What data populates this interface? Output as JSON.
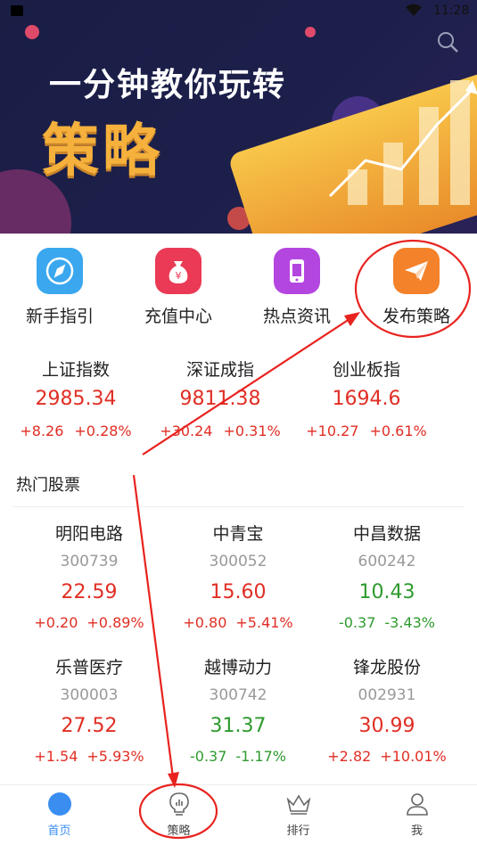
{
  "statusbar": {
    "time": "11:28"
  },
  "banner": {
    "title": "一分钟教你玩转",
    "big_text": "策略"
  },
  "quick_menu": [
    {
      "label": "新手指引",
      "icon": "compass-icon",
      "color": "#3aa7ef"
    },
    {
      "label": "充值中心",
      "icon": "money-bag-icon",
      "color": "#ea3a55"
    },
    {
      "label": "热点资讯",
      "icon": "phone-news-icon",
      "color": "#b446e0"
    },
    {
      "label": "发布策略",
      "icon": "paper-plane-icon",
      "color": "#f3822a"
    }
  ],
  "indices": [
    {
      "name": "上证指数",
      "value": "2985.34",
      "change": "+8.26",
      "percent": "+0.28%"
    },
    {
      "name": "深证成指",
      "value": "9811.38",
      "change": "+30.24",
      "percent": "+0.31%"
    },
    {
      "name": "创业板指",
      "value": "1694.6",
      "change": "+10.27",
      "percent": "+0.61%"
    }
  ],
  "hot_stocks": {
    "title": "热门股票",
    "items": [
      {
        "name": "明阳电路",
        "code": "300739",
        "price": "22.59",
        "change": "+0.20",
        "percent": "+0.89%",
        "trend": "up"
      },
      {
        "name": "中青宝",
        "code": "300052",
        "price": "15.60",
        "change": "+0.80",
        "percent": "+5.41%",
        "trend": "up"
      },
      {
        "name": "中昌数据",
        "code": "600242",
        "price": "10.43",
        "change": "-0.37",
        "percent": "-3.43%",
        "trend": "down"
      },
      {
        "name": "乐普医疗",
        "code": "300003",
        "price": "27.52",
        "change": "+1.54",
        "percent": "+5.93%",
        "trend": "up"
      },
      {
        "name": "越博动力",
        "code": "300742",
        "price": "31.37",
        "change": "-0.37",
        "percent": "-1.17%",
        "trend": "down"
      },
      {
        "name": "锋龙股份",
        "code": "002931",
        "price": "30.99",
        "change": "+2.82",
        "percent": "+10.01%",
        "trend": "up"
      }
    ]
  },
  "tabs": [
    {
      "label": "首页",
      "icon": "home-dot-icon",
      "active": true
    },
    {
      "label": "策略",
      "icon": "lightbulb-chart-icon",
      "active": false
    },
    {
      "label": "排行",
      "icon": "crown-icon",
      "active": false
    },
    {
      "label": "我",
      "icon": "user-icon",
      "active": false
    }
  ],
  "colors": {
    "up": "#e02e24",
    "down": "#2e9a2e",
    "accent": "#3a8ef0",
    "annotation": "#e8231f"
  }
}
